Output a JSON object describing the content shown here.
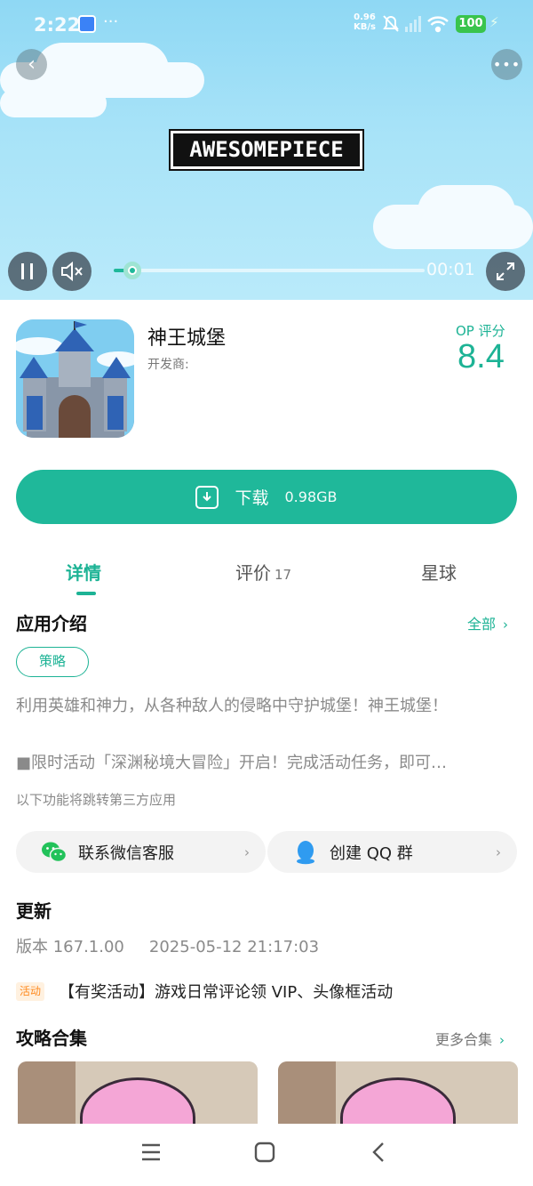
{
  "status_bar": {
    "time": "2:22",
    "net_speed": "0.96",
    "net_unit": "KB/s",
    "battery": "100"
  },
  "video": {
    "logo_text": "AWESOMEPIECE",
    "time": "00:01",
    "progress_fraction": 0.06
  },
  "app": {
    "name": "神王城堡",
    "developer_label": "开发商:",
    "score_label": "OP 评分",
    "score": "8.4"
  },
  "download": {
    "label": "下载",
    "size": "0.98GB"
  },
  "tabs": [
    {
      "label": "详情",
      "count": ""
    },
    {
      "label": "评价",
      "count": "17"
    },
    {
      "label": "星球",
      "count": ""
    }
  ],
  "intro": {
    "title": "应用介绍",
    "more": "全部",
    "tag": "策略",
    "line1": "利用英雄和神力，从各种敌人的侵略中守护城堡！神王城堡！",
    "line2": "■限时活动「深渊秘境大冒险」开启！完成活动任务，即可…",
    "third_party_note": "以下功能将跳转第三方应用"
  },
  "links": [
    {
      "label": "联系微信客服",
      "icon": "wechat-icon"
    },
    {
      "label": "创建 QQ 群",
      "icon": "qq-icon"
    }
  ],
  "update": {
    "title": "更新",
    "version": "版本 167.1.00",
    "date": "2025-05-12 21:17:03",
    "badge": "活动",
    "activity": "【有奖活动】游戏日常评论领 VIP、头像框活动"
  },
  "guides": {
    "title": "攻略合集",
    "more": "更多合集"
  },
  "colors": {
    "accent": "#1db395",
    "badge_bg": "#fff1e0",
    "badge_text": "#ff8a1f"
  }
}
